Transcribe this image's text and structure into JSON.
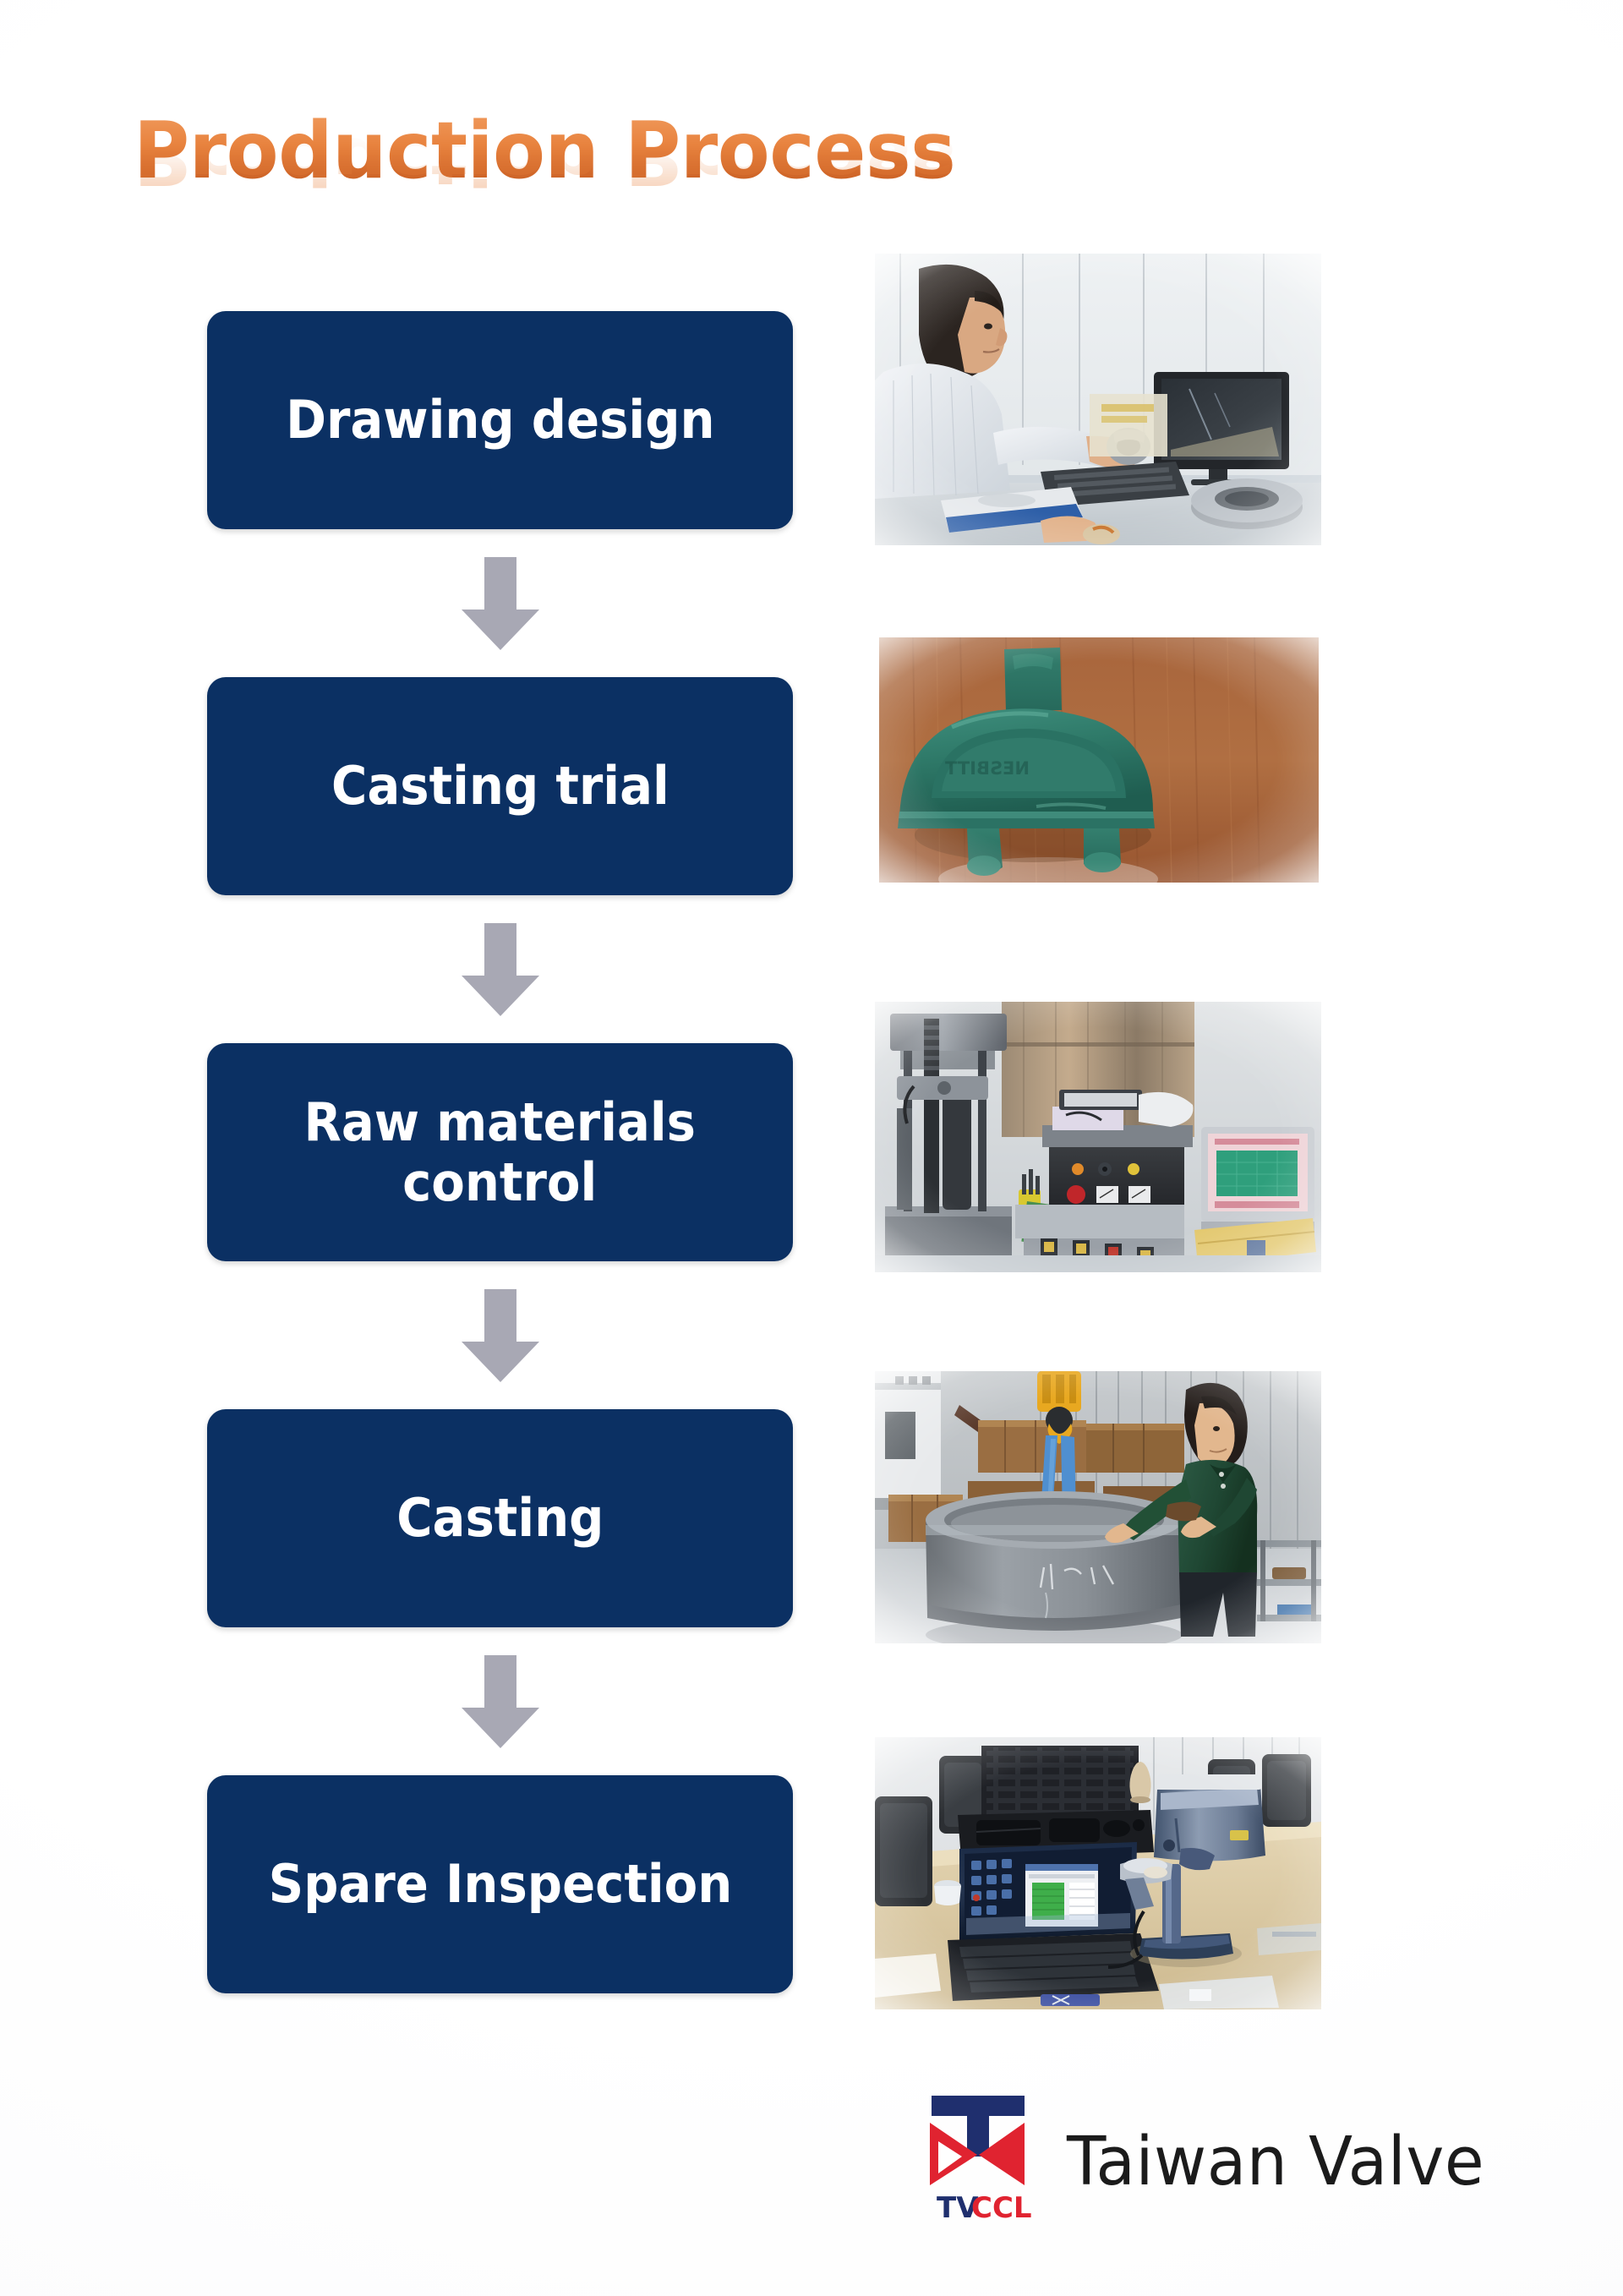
{
  "page": {
    "title": "Production Process",
    "background_color": "#ffffff"
  },
  "theme": {
    "title_orange": "#e8833f",
    "title_orange_dark": "#c45d22",
    "box_navy": "#0b3063",
    "arrow_gray": "#a8a8b4",
    "box_text": "#ffffff",
    "logo_navy": "#1f2f6e",
    "logo_red": "#e02330",
    "logo_word_color": "#1b1b1b"
  },
  "flow": {
    "steps": [
      {
        "id": "drawing-design",
        "label": "Drawing design",
        "lines": [
          "Drawing design"
        ],
        "photo_alt": "Engineer at CAD workstation holding a cast valve part",
        "photo_name": "drawing-design-photo"
      },
      {
        "id": "casting-trial",
        "label": "Casting trial",
        "lines": [
          "Casting trial"
        ],
        "photo_alt": "Green casting pattern prototype on a wooden table",
        "photo_name": "casting-trial-photo"
      },
      {
        "id": "raw-materials-control",
        "label": "Raw materials control",
        "lines": [
          "Raw materials",
          "control"
        ],
        "photo_alt": "Universal tensile testing machine with control panel and monitor",
        "photo_name": "raw-materials-control-photo"
      },
      {
        "id": "casting",
        "label": "Casting",
        "lines": [
          "Casting"
        ],
        "photo_alt": "Worker beside a large grey casting lifted by an overhead hoist",
        "photo_name": "casting-photo"
      },
      {
        "id": "spare-inspection",
        "label": "Spare Inspection",
        "lines": [
          "Spare Inspection"
        ],
        "photo_alt": "Laptop with measurement software next to an optical measuring microscope",
        "photo_name": "spare-inspection-photo"
      }
    ],
    "arrow_icon": "arrow-down-icon",
    "arrow_count": 4
  },
  "logo": {
    "wordmark": "Taiwan Valve",
    "mark_text": "TVCCL",
    "mark_text_navy_part": "TV",
    "mark_text_red_part": "CCL",
    "mark_name": "tvccl-logo-mark"
  }
}
